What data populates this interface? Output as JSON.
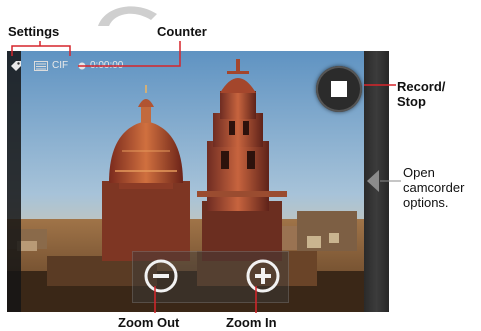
{
  "callouts": {
    "settings": "Settings",
    "counter": "Counter",
    "record_stop_line1": "Record/",
    "record_stop_line2": "Stop",
    "open_line1": "Open",
    "open_line2": "camcorder",
    "open_line3": "options.",
    "zoom_out": "Zoom Out",
    "zoom_in": "Zoom In"
  },
  "status_bar": {
    "format": "CIF",
    "timer": "0:00:00"
  },
  "icons": {
    "settings": "tag-icon",
    "storage": "storage-icon",
    "recording_dot": "record-dot-icon",
    "record_stop": "stop-square-icon",
    "zoom_out": "minus-circle-icon",
    "zoom_in": "plus-circle-icon",
    "options": "chevron-left-icon"
  },
  "colors": {
    "callout_line": "#d6252b",
    "screen_bg": "#1d1d1d"
  }
}
